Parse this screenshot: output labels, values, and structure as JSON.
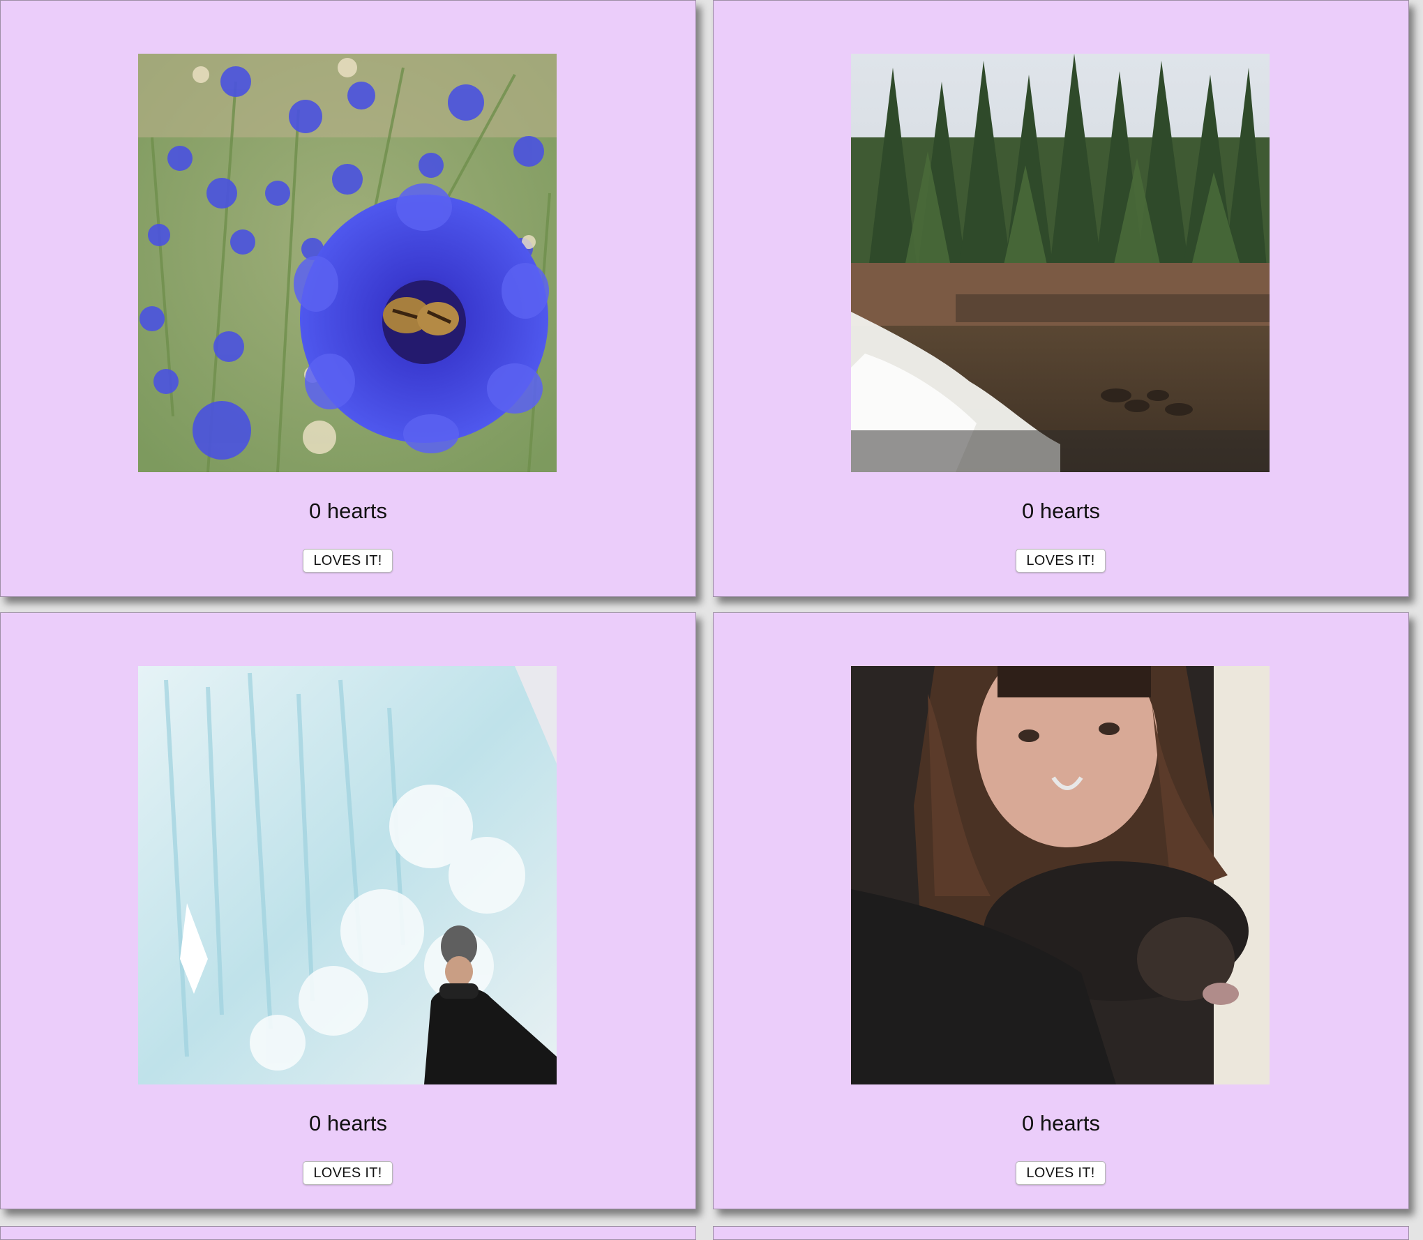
{
  "cards": [
    {
      "image": "flower-bee-photo",
      "hearts": "0 hearts",
      "button": "LOVES IT!"
    },
    {
      "image": "waterfall-forest-photo",
      "hearts": "0 hearts",
      "button": "LOVES IT!"
    },
    {
      "image": "ice-castle-person-photo",
      "hearts": "0 hearts",
      "button": "LOVES IT!"
    },
    {
      "image": "person-with-cat-photo",
      "hearts": "0 hearts",
      "button": "LOVES IT!"
    }
  ],
  "colors": {
    "card_background": "#ebcdfa",
    "button_background": "#ffffff"
  }
}
